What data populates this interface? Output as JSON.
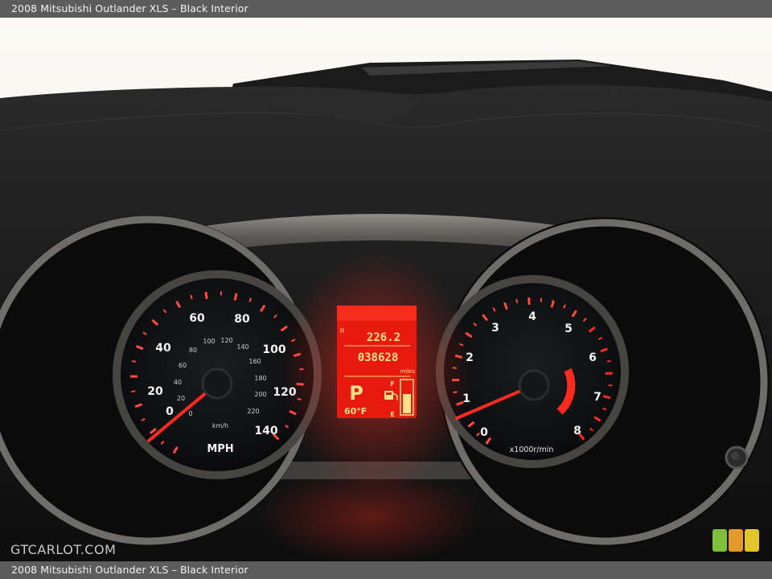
{
  "caption": {
    "top": "2008 Mitsubishi Outlander XLS – Black Interior",
    "bottom": "2008 Mitsubishi Outlander XLS – Black Interior"
  },
  "watermark": "GTCARLOT.COM",
  "speedometer": {
    "mph_labels": [
      "0",
      "20",
      "40",
      "60",
      "80",
      "100",
      "120",
      "140"
    ],
    "kmh_labels": [
      "0",
      "20",
      "40",
      "60",
      "80",
      "100",
      "120",
      "140",
      "160",
      "180",
      "200",
      "220"
    ],
    "unit_mph": "MPH",
    "unit_kmh": "km/h",
    "reading_mph": 0
  },
  "tachometer": {
    "labels": [
      "0",
      "1",
      "2",
      "3",
      "4",
      "5",
      "6",
      "7",
      "8"
    ],
    "unit": "x1000r/min",
    "reading_rpm_x1000": 0.6
  },
  "display": {
    "trip": "226.2",
    "trip_prefix": "H",
    "odometer": "038628",
    "odometer_unit": "miles",
    "gear": "P",
    "fuel_full": "F",
    "fuel_empty": "E",
    "fuel_level": 0.6,
    "temperature": "60°F"
  },
  "colors": {
    "caption_bar": "#5c5c5c",
    "needle": "#ff2a1e",
    "display_bg": "#e8190f",
    "display_text": "#ffe08a"
  }
}
